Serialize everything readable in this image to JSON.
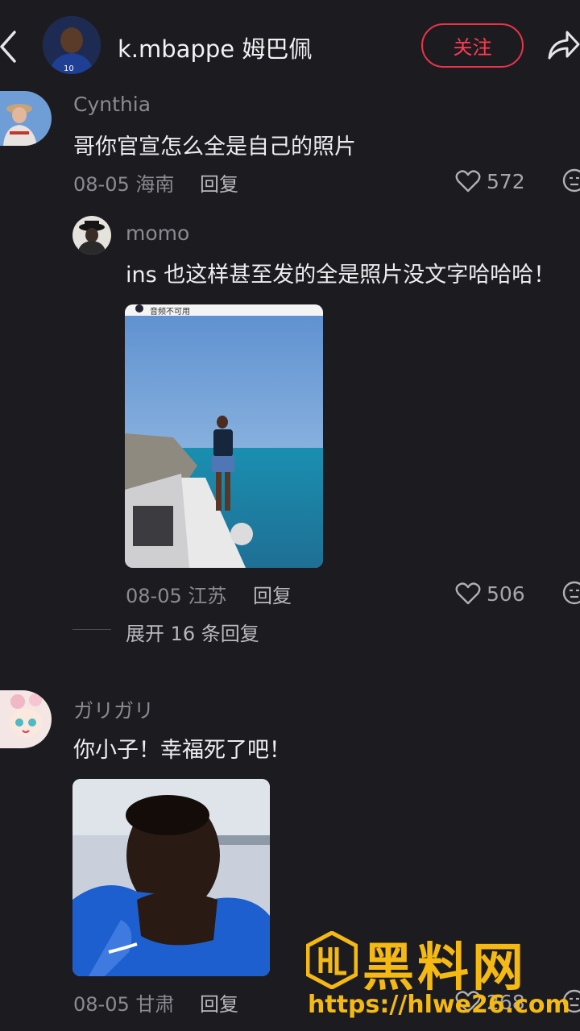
{
  "header": {
    "username": "k.mbappe 姆巴佩",
    "follow_label": "关注"
  },
  "comments": [
    {
      "username": "Cynthia",
      "text": "哥你官宣怎么全是自己的照片",
      "date": "08-05",
      "location": "海南",
      "reply_label": "回复",
      "likes": "572"
    },
    {
      "username": "momo",
      "text": "ins 也这样甚至发的全是照片没文字哈哈哈！",
      "date": "08-05",
      "location": "江苏",
      "reply_label": "回复",
      "likes": "506",
      "image_caption": "音频不可用"
    },
    {
      "username": "ガリガリ",
      "text": "你小子！幸福死了吧！",
      "date": "08-05",
      "location": "甘肃",
      "reply_label": "回复",
      "likes": "268"
    }
  ],
  "expand_replies": "展开 16 条回复",
  "watermark": {
    "title": "黑料网",
    "url": "https://hlwe26.com"
  },
  "colors": {
    "background": "#1c1c20",
    "follow_accent": "#ff3b52",
    "watermark": "#f5b913"
  },
  "icons": [
    "back-icon",
    "share-icon",
    "heart-icon",
    "face-icon",
    "watermark-logo-icon"
  ]
}
